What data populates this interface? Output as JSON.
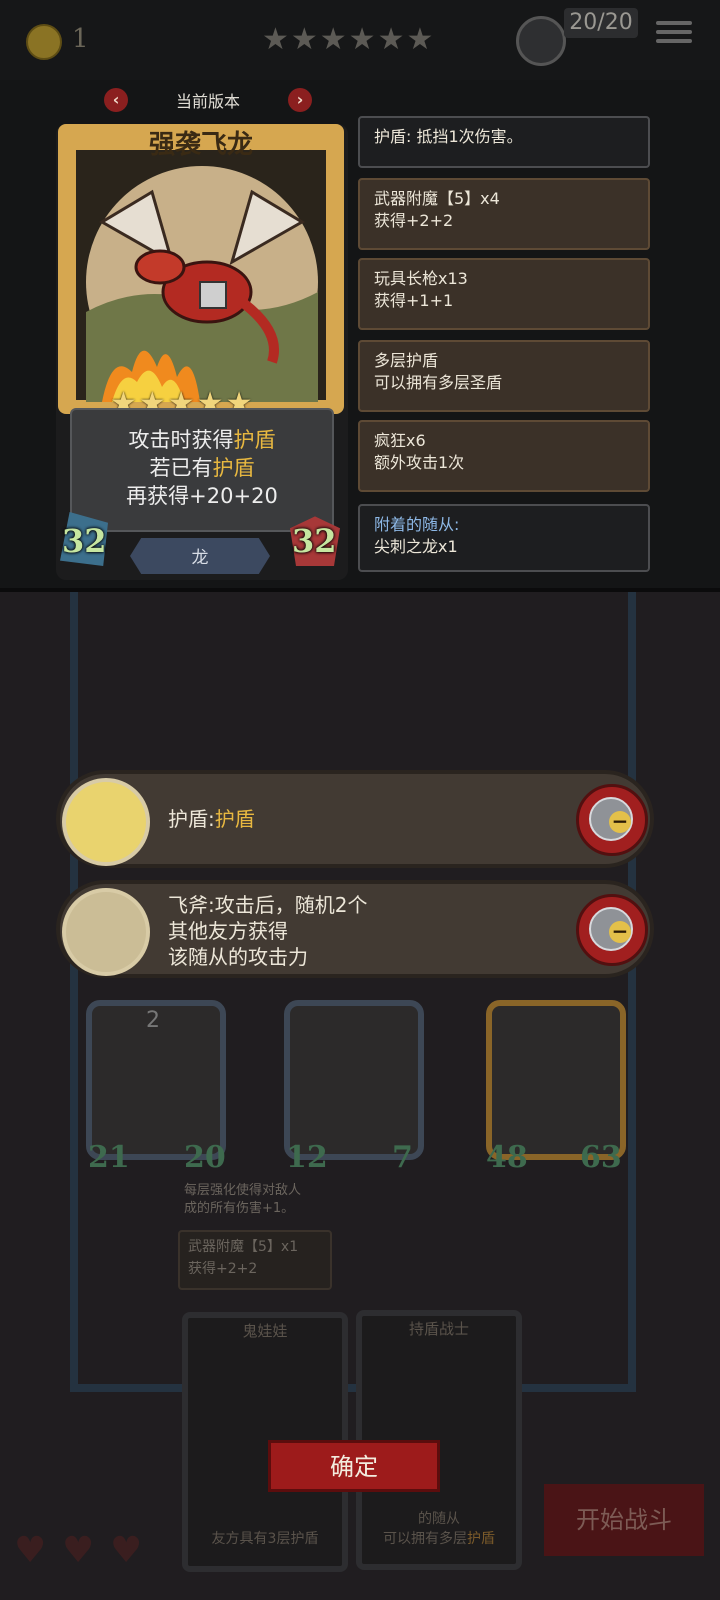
{
  "hud": {
    "coins": "1",
    "level_stars": "★★★★★★",
    "health_badge": "20/20"
  },
  "version": {
    "label": "当前版本"
  },
  "card": {
    "title": "强袭飞龙",
    "stars": "★★★★★",
    "desc_line1_a": "攻击时获得",
    "desc_line1_b": "护盾",
    "desc_line2_a": "若已有",
    "desc_line2_b": "护盾",
    "desc_line3": "再获得+20+20",
    "tribe": "龙",
    "attack": "32",
    "health": "32"
  },
  "info_panels": [
    {
      "line1": "护盾: 抵挡1次伤害。"
    },
    {
      "line1": "武器附魔【5】x4",
      "line2": "获得+2+2"
    },
    {
      "line1": "玩具长枪x13",
      "line2": "获得+1+1"
    },
    {
      "line1": "多层护盾",
      "line2": "可以拥有多层圣盾"
    },
    {
      "line1": "疯狂x6",
      "line2": "额外攻击1次"
    },
    {
      "line1": "附着的随从:",
      "line2": "尖刺之龙x1"
    }
  ],
  "keywords": [
    {
      "prefix": "护盾:",
      "highlight": "护盾"
    },
    {
      "line1": "飞斧:攻击后，随机2个",
      "line2": "其他友方获得",
      "line3": "该随从的攻击力"
    }
  ],
  "board": {
    "minions": [
      {
        "tier": "2",
        "attack": "21",
        "health": "20"
      },
      {
        "attack": "12",
        "health": "7"
      },
      {
        "attack": "48",
        "health": "63"
      }
    ],
    "faint_line1": "每层强化使得对敌人",
    "faint_line2": "成的所有伤害+1。",
    "faint_box_line1": "武器附魔【5】x1",
    "faint_box_line2": "获得+2+2"
  },
  "hand": [
    {
      "title": "鬼娃娃",
      "text": "友方具有3层护盾"
    },
    {
      "title": "持盾战士",
      "text_line1": "的随从",
      "text_line2_a": "可以拥有多层",
      "text_line2_b": "护盾"
    }
  ],
  "buttons": {
    "confirm": "确定",
    "start_battle": "开始战斗"
  },
  "colors": {
    "card_frame": "#d6a750",
    "highlight": "#e8b840",
    "confirm_button": "#9d1b1b",
    "keyword_blue": "#8db8e6"
  }
}
